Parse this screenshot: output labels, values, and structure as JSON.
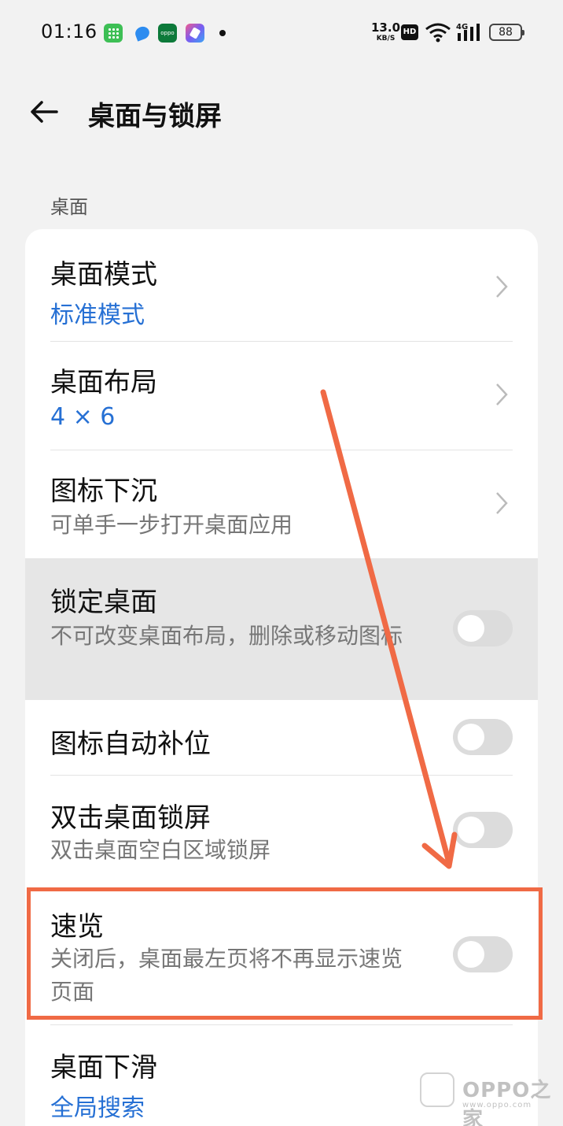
{
  "status_bar": {
    "time": "01:16",
    "net_speed": "13.0",
    "net_unit": "KB/S",
    "hd": "HD",
    "network_type": "4G",
    "battery": "88",
    "app_icons": [
      "grid-app-icon",
      "bird-app-icon",
      "oppo-app-icon",
      "shortcut-app-icon"
    ]
  },
  "header": {
    "title": "桌面与锁屏"
  },
  "section": {
    "label": "桌面"
  },
  "settings": [
    {
      "title": "桌面模式",
      "value": "标准模式",
      "type": "nav"
    },
    {
      "title": "桌面布局",
      "value": "4 × 6",
      "type": "nav"
    },
    {
      "title": "图标下沉",
      "subtitle": "可单手一步打开桌面应用",
      "type": "nav"
    },
    {
      "title": "锁定桌面",
      "subtitle": "不可改变桌面布局，删除或移动图标",
      "type": "toggle",
      "on": false
    },
    {
      "title": "图标自动补位",
      "type": "toggle",
      "on": false
    },
    {
      "title": "双击桌面锁屏",
      "subtitle": "双击桌面空白区域锁屏",
      "type": "toggle",
      "on": false
    },
    {
      "title": "速览",
      "subtitle": "关闭后，桌面最左页将不再显示速览页面",
      "type": "toggle",
      "on": false
    },
    {
      "title": "桌面下滑",
      "value": "全局搜索",
      "type": "nav"
    }
  ],
  "colors": {
    "accent": "#2670d4",
    "annotation": "#f06a45",
    "highlight_row": "#e6e6e6"
  },
  "watermark": {
    "text": "OPPO之家",
    "url": "www.oppo.com"
  }
}
